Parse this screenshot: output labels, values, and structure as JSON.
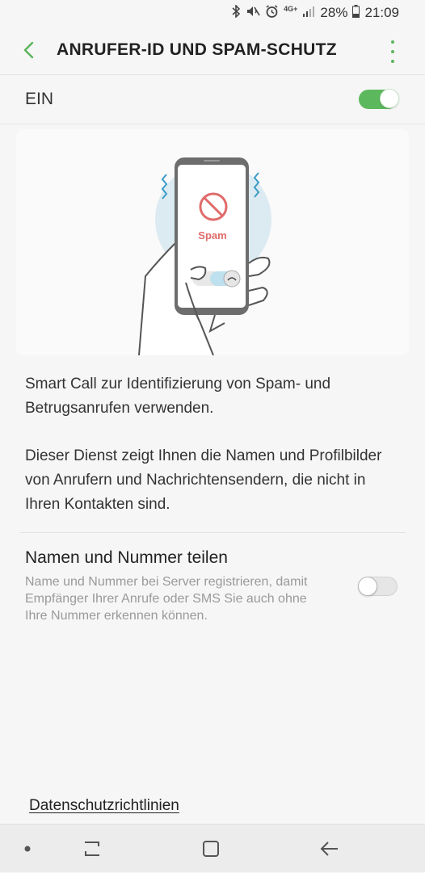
{
  "status_bar": {
    "network": "4G+",
    "battery_percent": "28%",
    "time": "21:09",
    "icons": [
      "bluetooth-icon",
      "mute-icon",
      "alarm-icon",
      "network-4g-icon",
      "signal-icon",
      "battery-icon"
    ]
  },
  "header": {
    "title": "ANRUFER-ID UND SPAM-SCHUTZ",
    "accent_color": "#5ab55b"
  },
  "master_switch": {
    "label": "EIN",
    "on": true
  },
  "illustration": {
    "label": "Spam"
  },
  "description": {
    "paragraph1": "Smart Call zur Identifizierung von Spam- und Betrugsanrufen verwenden.",
    "paragraph2": "Dieser Dienst zeigt Ihnen die Namen und Profil­bilder von Anrufern und Nachrichtensendern, die nicht in Ihren Kontakten sind."
  },
  "share_setting": {
    "title": "Namen und Nummer teilen",
    "subtitle": "Name und Nummer bei Server registrieren, damit Empfänger Ihrer Anrufe oder SMS Sie auch ohne Ihre Nummer erkennen können.",
    "on": false
  },
  "footer": {
    "privacy_link": "Datenschutzrichtlinien"
  },
  "nav_bar": {
    "items": [
      "dot-icon",
      "recents-icon",
      "home-icon",
      "back-icon"
    ]
  }
}
